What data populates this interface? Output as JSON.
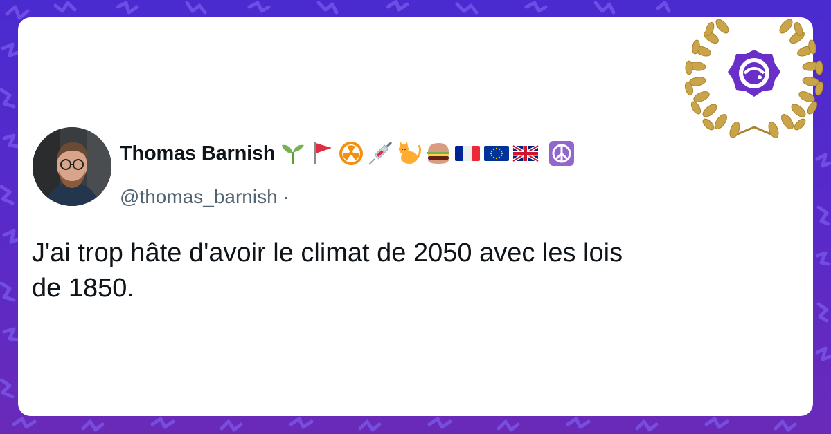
{
  "author": {
    "name": "Thomas Barnish",
    "handle": "@thomas_barnish",
    "separator": "·",
    "name_emojis": [
      "seedling-icon",
      "red-flag-icon",
      "radioactive-icon",
      "syringe-icon",
      "cat-icon",
      "hamburger-icon",
      "france-flag-icon",
      "eu-flag-icon",
      "uk-flag-icon",
      "peace-symbol-icon"
    ]
  },
  "tweet": {
    "text_line1": "J'ai trop hâte d'avoir le climat de 2050 avec les lois",
    "text_line2": "de 1850."
  },
  "colors": {
    "background": "#4a2bd0",
    "card": "#ffffff",
    "name": "#0f1419",
    "handle": "#536471",
    "badge_purple": "#6b2fc9",
    "laurel_gold": "#c9a449"
  }
}
